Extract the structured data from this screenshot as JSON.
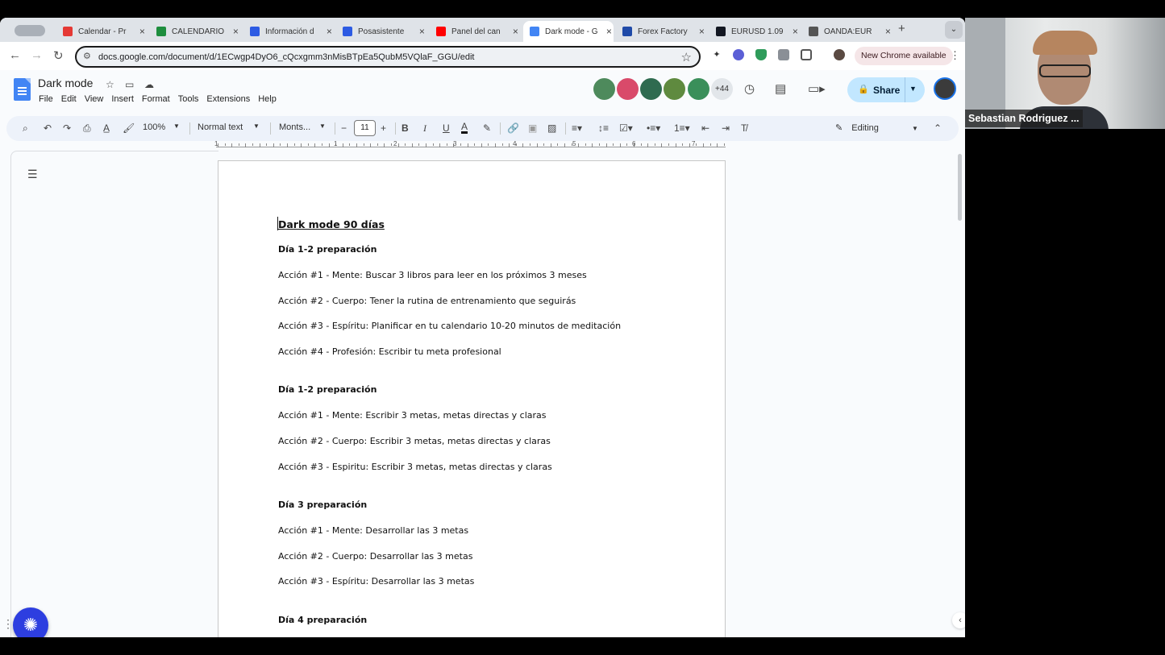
{
  "browser": {
    "tabs": [
      {
        "title": "Calendar - Pr",
        "favicon": "simplybook-icon",
        "color": "#e53935"
      },
      {
        "title": "CALENDARIO",
        "favicon": "sheets-icon",
        "color": "#1e8e3e"
      },
      {
        "title": "Información d",
        "favicon": "zoom-icon",
        "color": "#2d5be3"
      },
      {
        "title": "Posasistente",
        "favicon": "zoom-icon",
        "color": "#2d5be3"
      },
      {
        "title": "Panel del can",
        "favicon": "youtube-icon",
        "color": "#ff0000"
      },
      {
        "title": "Dark mode - G",
        "favicon": "docs-icon",
        "color": "#4285f4",
        "active": true
      },
      {
        "title": "Forex Factory",
        "favicon": "forexfactory-icon",
        "color": "#1f4aa8"
      },
      {
        "title": "EURUSD 1.09",
        "favicon": "tradingview-icon",
        "color": "#131722"
      },
      {
        "title": "OANDA:EUR",
        "favicon": "oanda-icon",
        "color": "#555555"
      }
    ],
    "url": "docs.google.com/document/d/1ECwgp4DyO6_cQcxgmm3nMisBTpEa5QubM5VQlaF_GGU/edit",
    "new_chrome": "New Chrome available"
  },
  "doc": {
    "title": "Dark mode",
    "menu": [
      "File",
      "Edit",
      "View",
      "Insert",
      "Format",
      "Tools",
      "Extensions",
      "Help"
    ],
    "collaborator_count": "+44",
    "share_label": "Share"
  },
  "toolbar": {
    "zoom": "100%",
    "style": "Normal text",
    "font": "Monts...",
    "font_size": "11",
    "mode": "Editing"
  },
  "ruler": [
    "1",
    "1",
    "2",
    "3",
    "4",
    "5",
    "6",
    "7"
  ],
  "content": {
    "title": "Dark mode 90 días",
    "sections": [
      {
        "heading": "Día 1-2 preparación",
        "items": [
          "Acción #1 - Mente: Buscar 3 libros para leer en los próximos 3 meses",
          "Acción #2 - Cuerpo: Tener la rutina de entrenamiento que seguirás",
          "Acción #3 - Espíritu: Planificar en tu calendario 10-20 minutos de meditación",
          "Acción #4 - Profesión: Escribir tu meta profesional"
        ]
      },
      {
        "heading": "Día 1-2 preparación",
        "items": [
          "Acción #1 - Mente: Escribir 3 metas, metas directas y claras",
          "Acción #2 - Cuerpo: Escribir 3 metas, metas directas y claras",
          "Acción #3 - Espiritu: Escribir 3 metas, metas directas y claras"
        ]
      },
      {
        "heading": "Día 3 preparación",
        "items": [
          "Acción #1 - Mente: Desarrollar las  3 metas",
          "Acción #2 - Cuerpo: Desarrollar las  3 metas",
          "Acción #3 - Espíritu: Desarrollar las  3 metas"
        ]
      },
      {
        "heading": "Día 4 preparación",
        "items": []
      }
    ]
  },
  "webcam": {
    "name": "Sebastian Rodriguez ..."
  }
}
